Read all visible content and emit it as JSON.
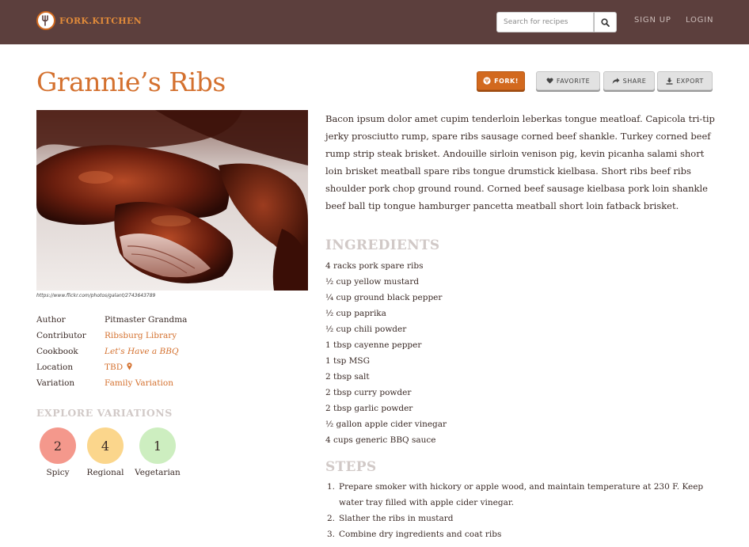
{
  "navbar": {
    "brand": "FORK.KITCHEN",
    "search_placeholder": "Search for recipes",
    "signup": "SIGN UP",
    "login": "LOGIN",
    "background": "#5c3f3d"
  },
  "recipe": {
    "title": "Grannie’s Ribs",
    "actions": {
      "fork": "FORK!",
      "favorite": "FAVORITE",
      "share": "SHARE",
      "export": "EXPORT"
    },
    "photo_credit": "https://www.flickr.com/photos/galant/2743643789",
    "meta": [
      {
        "label": "Author",
        "value": "Pitmaster Grandma"
      },
      {
        "label": "Contributor",
        "value": "Ribsburg Library"
      },
      {
        "label": "Cookbook",
        "value": "Let's Have a BBQ"
      },
      {
        "label": "Location",
        "value": "TBD"
      },
      {
        "label": "Variation",
        "value": "Family Variation"
      }
    ],
    "explore_heading": "EXPLORE VARIATIONS",
    "variations": [
      {
        "count": "2",
        "label": "Spicy",
        "color": "#f4988c"
      },
      {
        "count": "4",
        "label": "Regional",
        "color": "#fbd68c"
      },
      {
        "count": "1",
        "label": "Vegetarian",
        "color": "#cdeec0"
      }
    ],
    "description": "Bacon ipsum dolor amet cupim tenderloin leberkas tongue meatloaf. Capicola tri-tip jerky prosciutto rump, spare ribs sausage corned beef shankle. Turkey corned beef rump strip steak brisket. Andouille sirloin venison pig, kevin picanha salami short loin brisket meatball spare ribs tongue drumstick kielbasa. Short ribs beef ribs shoulder pork chop ground round. Corned beef sausage kielbasa pork loin shankle beef ball tip tongue hamburger pancetta meatball short loin fatback brisket.",
    "ingredients_heading": "INGREDIENTS",
    "ingredients": [
      "4 racks pork spare ribs",
      "½ cup yellow mustard",
      "¼ cup ground black pepper",
      "½ cup paprika",
      "½ cup chili powder",
      "1 tbsp cayenne pepper",
      "1 tsp MSG",
      "2 tbsp salt",
      "2 tbsp curry powder",
      "2 tbsp garlic powder",
      "½ gallon apple cider vinegar",
      "4 cups generic BBQ sauce"
    ],
    "steps_heading": "STEPS",
    "steps": [
      {
        "num": "1.",
        "text": "Prepare smoker with hickory or apple wood, and maintain temperature at 230 F. Keep water tray filled with apple cider vinegar."
      },
      {
        "num": "2.",
        "text": "Slather the ribs in mustard"
      },
      {
        "num": "3.",
        "text": "Combine dry ingredients and coat ribs"
      }
    ]
  },
  "colors": {
    "accent": "#d4712f",
    "heading_muted": "#d1c9c7"
  }
}
